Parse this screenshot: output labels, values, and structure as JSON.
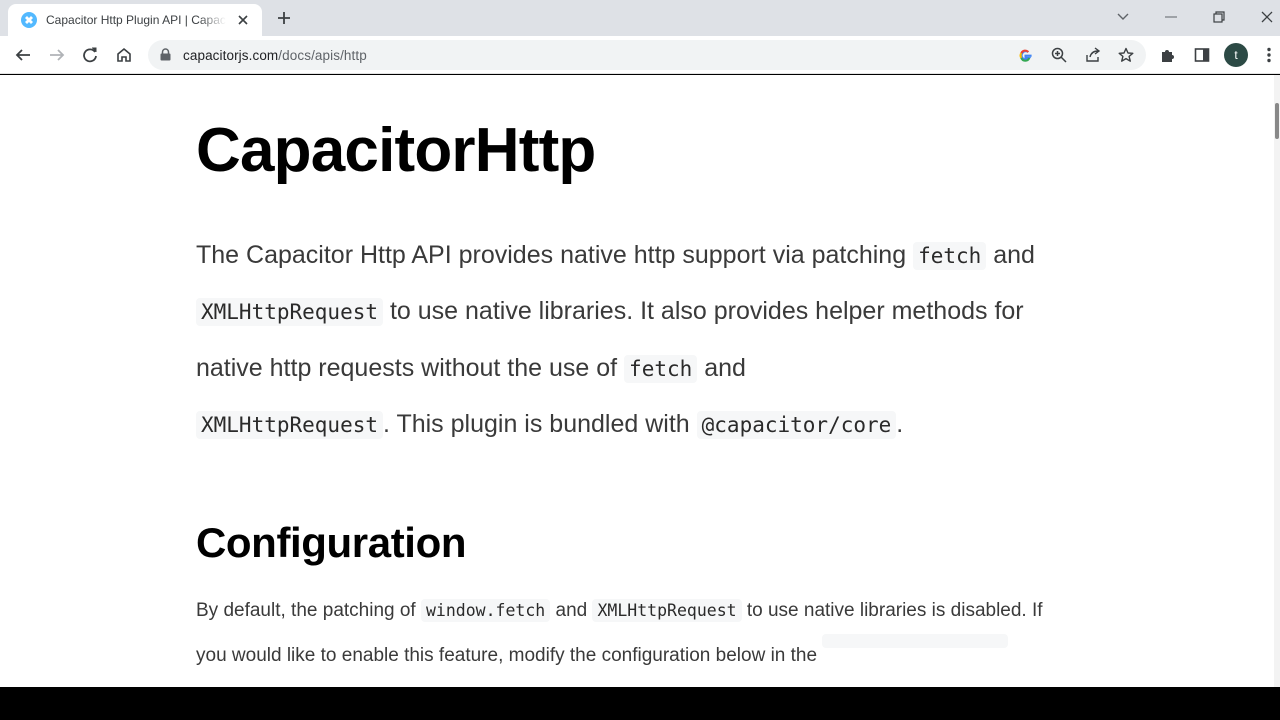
{
  "browser": {
    "tab_title": "Capacitor Http Plugin API | Capacitor",
    "url_host": "capacitorjs.com",
    "url_path": "/docs/apis/http",
    "profile_initial": "t",
    "accent": "#1a73e8"
  },
  "page": {
    "title": "CapacitorHttp",
    "intro": {
      "t1": "The Capacitor Http API provides native http support via patching ",
      "c1": "fetch",
      "t2": " and ",
      "c2": "XMLHttpRequest",
      "t3": " to use native libraries. It also provides helper methods for native http requests without the use of ",
      "c3": "fetch",
      "t4": " and ",
      "c4": "XMLHttpRequest",
      "t5": ". This plugin is bundled with ",
      "c5": "@capacitor/core",
      "t6": "."
    },
    "config_heading": "Configuration",
    "config": {
      "t1": "By default, the patching of ",
      "c1": "window.fetch",
      "t2": " and ",
      "c2": "XMLHttpRequest",
      "t3": " to use native libraries is disabled. If you would like to enable this feature, modify the configuration below in the "
    }
  }
}
